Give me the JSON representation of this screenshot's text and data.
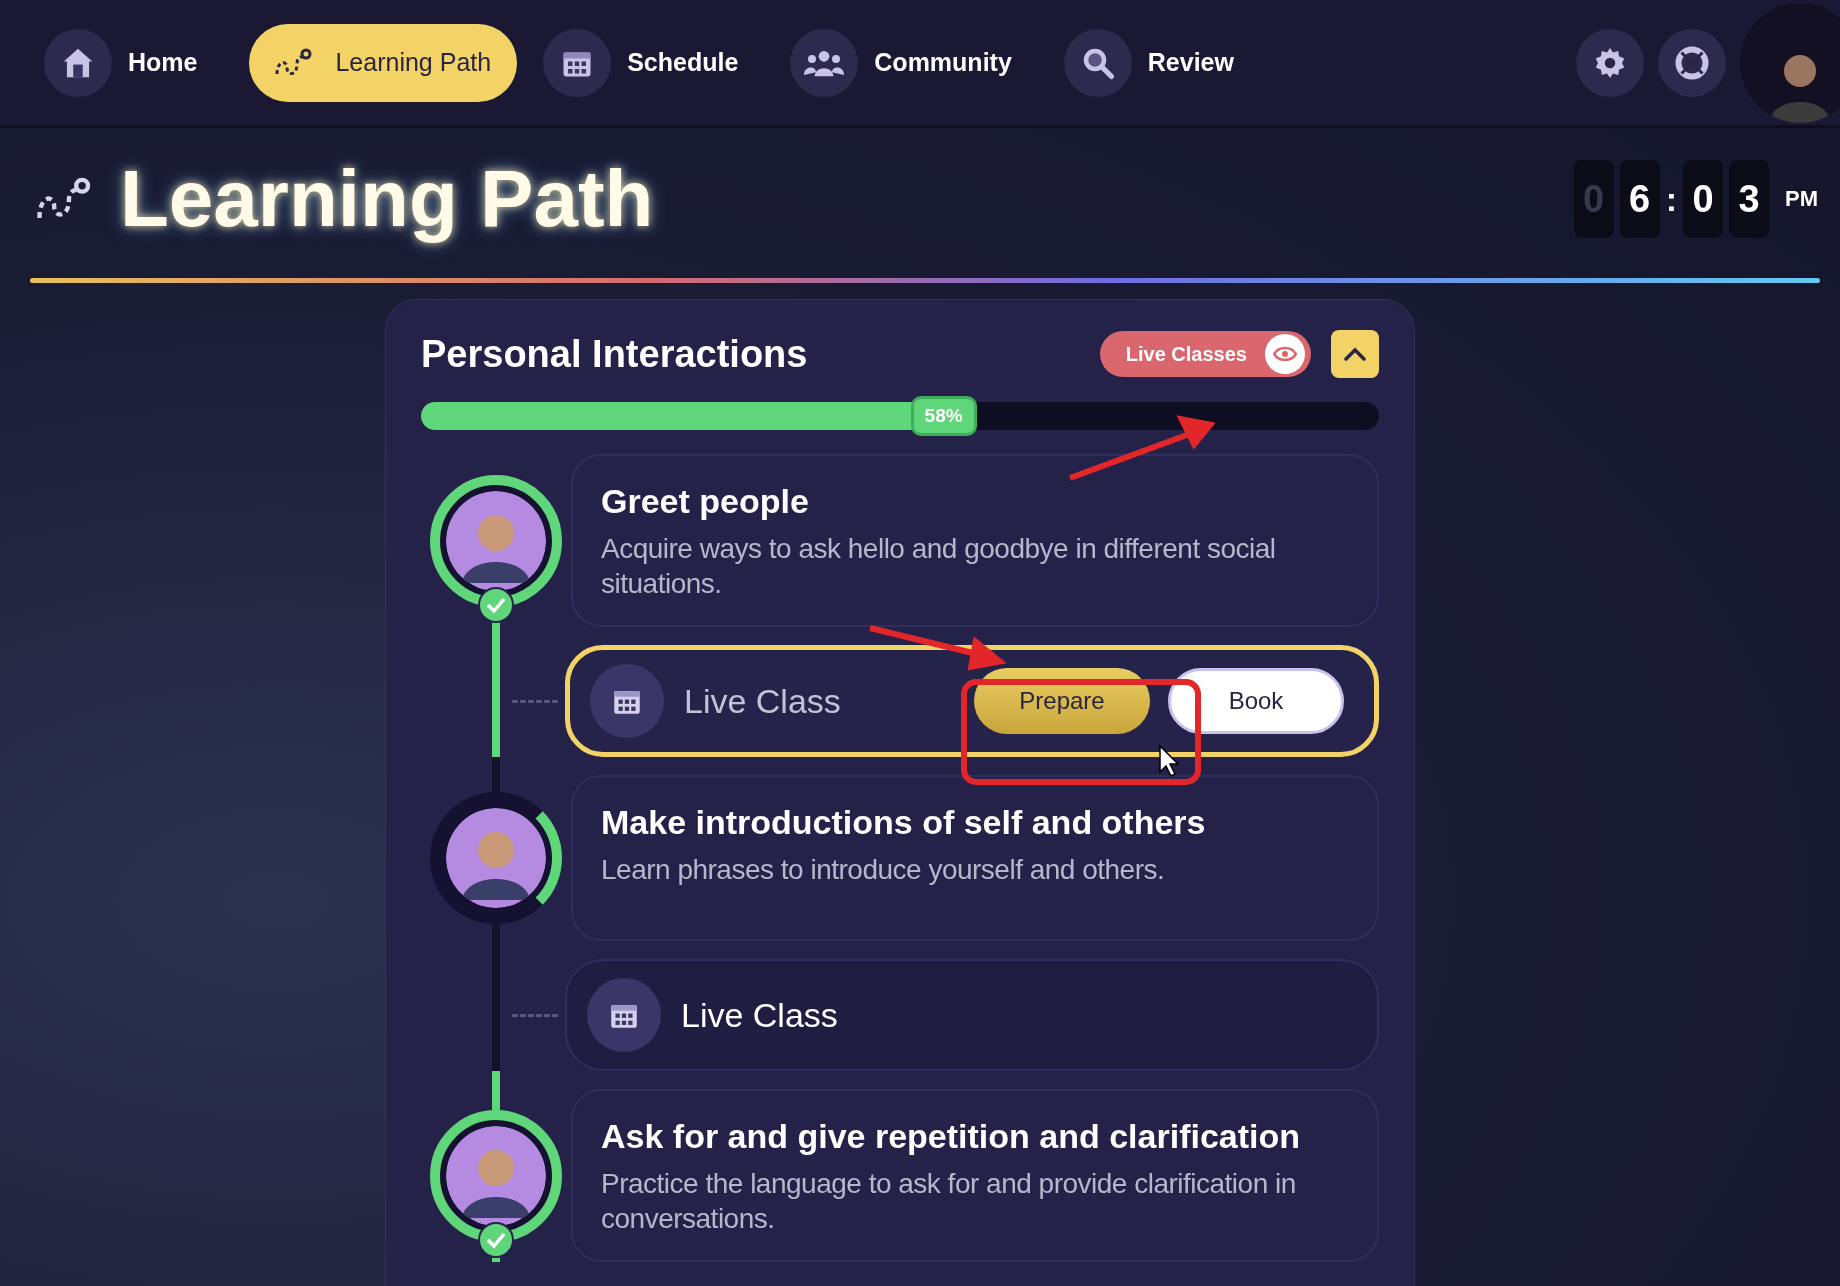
{
  "nav": {
    "items": [
      {
        "label": "Home",
        "selected": false
      },
      {
        "label": "Learning Path",
        "selected": true
      },
      {
        "label": "Schedule",
        "selected": false
      },
      {
        "label": "Community",
        "selected": false
      },
      {
        "label": "Review",
        "selected": false
      }
    ]
  },
  "page_title": "Learning Path",
  "clock": [
    {
      "kind": "digit",
      "text": "0",
      "dim": true
    },
    {
      "kind": "digit",
      "text": "6",
      "dim": false
    },
    {
      "kind": "separator",
      "text": ":",
      "dim": false
    },
    {
      "kind": "digit",
      "text": "0",
      "dim": false
    },
    {
      "kind": "digit",
      "text": "3",
      "dim": false
    },
    {
      "kind": "suffix",
      "text": "PM",
      "dim": false
    }
  ],
  "card": {
    "title": "Personal Interactions",
    "live_classes_toggle": {
      "label": "Live Classes",
      "on": true
    },
    "expanded": true,
    "progress": {
      "level": 0.58,
      "label": "58%"
    },
    "items": [
      {
        "kind": "lesson",
        "title": "Greet people",
        "description": "Acquire ways to ask hello and goodbye in different social situations.",
        "completed": true
      },
      {
        "kind": "live_class",
        "label": "Live Class",
        "highlighted": true,
        "buttons": [
          "Prepare",
          "Book"
        ]
      },
      {
        "kind": "lesson",
        "title": "Make introductions of self and others",
        "description": "Learn phrases to introduce yourself and others.",
        "completed": false
      },
      {
        "kind": "live_class",
        "label": "Live Class",
        "highlighted": false
      },
      {
        "kind": "lesson",
        "title": "Ask for and give repetition and clarification",
        "description": "Practice the language to ask for and provide clarification in conversations.",
        "completed": true
      }
    ]
  }
}
